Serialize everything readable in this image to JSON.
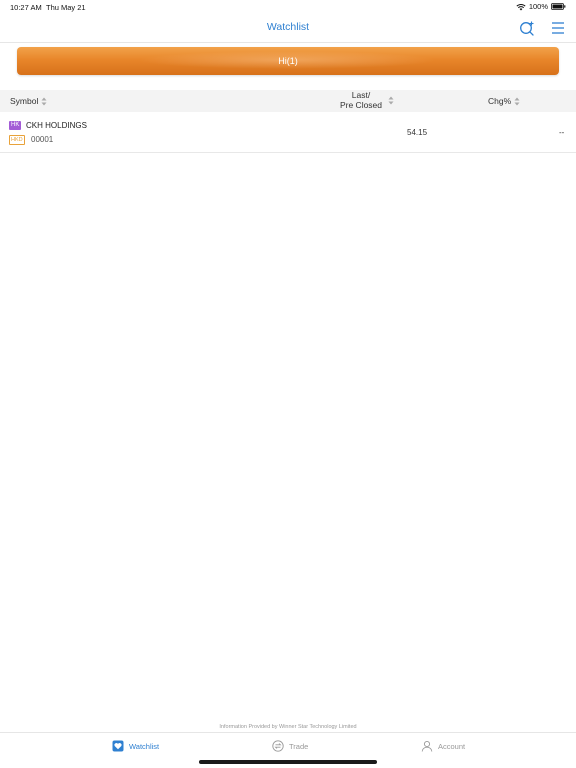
{
  "status_bar": {
    "time": "10:27 AM",
    "date": "Thu May 21",
    "battery": "100%"
  },
  "nav": {
    "title": "Watchlist",
    "icons": [
      "search-icon",
      "menu-icon"
    ]
  },
  "group_banner": {
    "label": "Hi(1)"
  },
  "table": {
    "headers": {
      "symbol": "Symbol",
      "last_line1": "Last/",
      "last_line2": "Pre Closed",
      "chg": "Chg%"
    },
    "rows": [
      {
        "market": "HK",
        "name": "CKH HOLDINGS",
        "currency": "HKD",
        "code": "00001",
        "last": "54.15",
        "chg": "--"
      }
    ]
  },
  "footer": {
    "provider": "Information Provided by Winner Star Technology Limited"
  },
  "tabbar": {
    "tabs": [
      {
        "label": "Watchlist",
        "icon": "heart-icon",
        "active": true
      },
      {
        "label": "Trade",
        "icon": "trade-icon",
        "active": false
      },
      {
        "label": "Account",
        "icon": "person-icon",
        "active": false
      }
    ]
  },
  "colors": {
    "accent": "#2f80d1",
    "banner": "#e8862a",
    "hk_badge": "#a35bd6",
    "hkd_badge": "#e8a23a"
  }
}
